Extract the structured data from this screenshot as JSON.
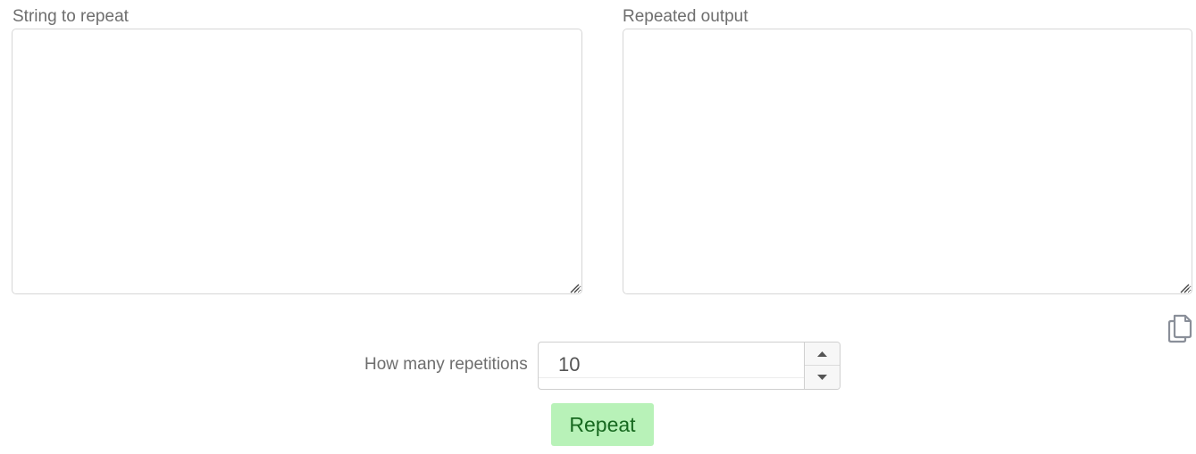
{
  "input_panel": {
    "label": "String to repeat",
    "value": ""
  },
  "output_panel": {
    "label": "Repeated output",
    "value": "",
    "copy_icon": "copy-icon"
  },
  "repetitions": {
    "label": "How many repetitions",
    "value": "10",
    "increment_icon": "caret-up-icon",
    "decrement_icon": "caret-down-icon"
  },
  "actions": {
    "repeat_label": "Repeat"
  },
  "colors": {
    "button_bg": "#b8f2b8",
    "button_text": "#17691f",
    "label_text": "#6e6e6e",
    "border": "#d6d6d6"
  }
}
